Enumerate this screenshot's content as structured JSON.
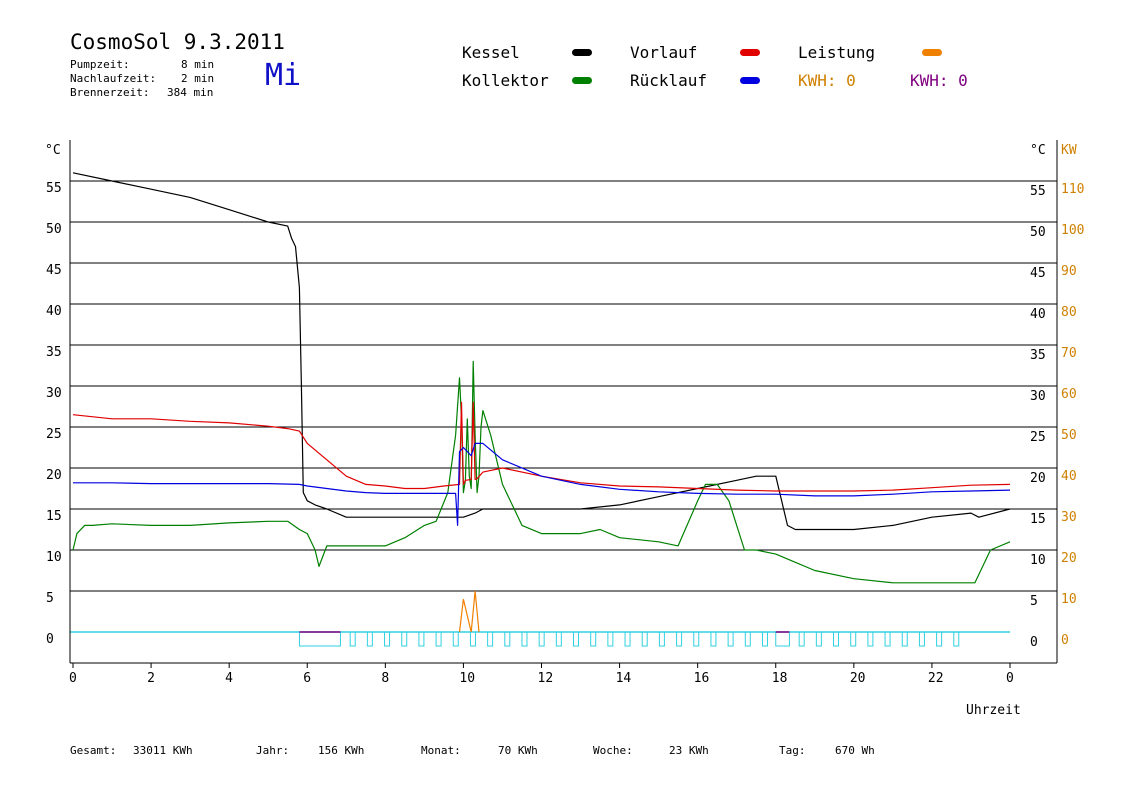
{
  "header": {
    "title": "CosmoSol 9.3.2011",
    "day": "Mi",
    "info": [
      {
        "label": "Pumpzeit:",
        "value": "8 min"
      },
      {
        "label": "Nachlaufzeit:",
        "value": "2 min"
      },
      {
        "label": "Brennerzeit:",
        "value": "384 min"
      }
    ]
  },
  "legend": {
    "kessel": {
      "label": "Kessel",
      "color": "#000000"
    },
    "kollektor": {
      "label": "Kollektor",
      "color": "#008000"
    },
    "vorlauf": {
      "label": "Vorlauf",
      "color": "#e00000"
    },
    "ruecklauf": {
      "label": "Rücklauf",
      "color": "#0000e0"
    },
    "leistung": {
      "label": "Leistung",
      "color": "#f08000"
    },
    "kwh_orange": {
      "label": "KWH: 0",
      "color": "#d08000"
    },
    "kwh_purple": {
      "label": "KWH: 0",
      "color": "#800080"
    }
  },
  "footer": [
    {
      "label": "Gesamt:",
      "value": "33011 KWh"
    },
    {
      "label": "Jahr:",
      "value": "156 KWh"
    },
    {
      "label": "Monat:",
      "value": "70 KWh"
    },
    {
      "label": "Woche:",
      "value": "23 KWh"
    },
    {
      "label": "Tag:",
      "value": "670 Wh"
    }
  ],
  "chart_data": {
    "type": "line",
    "xlabel": "Uhrzeit",
    "ylabel_left": "°C",
    "ylabel_right_1": "°C",
    "ylabel_right_2": "KW",
    "xlim": [
      0,
      24
    ],
    "ylim": [
      0,
      57
    ],
    "x_tick_labels": [
      "0",
      "2",
      "4",
      "6",
      "8",
      "10",
      "12",
      "14",
      "16",
      "18",
      "20",
      "22",
      "0"
    ],
    "y_ticks": [
      0,
      5,
      10,
      15,
      20,
      25,
      30,
      35,
      40,
      45,
      50,
      55
    ],
    "y_tick_labels": [
      "0",
      "5",
      "10",
      "15",
      "20",
      "25",
      "30",
      "35",
      "40",
      "45",
      "50",
      "55"
    ],
    "kw_tick_labels": [
      "0",
      "10",
      "20",
      "30",
      "40",
      "50",
      "60",
      "70",
      "80",
      "90",
      "100",
      "110"
    ],
    "grid": true,
    "series": [
      {
        "name": "Kessel",
        "color": "#000000",
        "x": [
          0,
          1,
          2,
          3,
          4,
          5,
          5.5,
          5.6,
          5.7,
          5.8,
          5.85,
          5.9,
          6,
          6.2,
          6.5,
          7,
          8,
          9,
          9.5,
          9.8,
          10,
          10.3,
          10.5,
          11,
          12,
          13,
          14,
          15,
          16,
          17,
          17.5,
          18,
          18.1,
          18.3,
          18.5,
          19,
          20,
          21,
          22,
          23,
          23.2,
          24
        ],
        "y": [
          56,
          55,
          54,
          53,
          51.5,
          50,
          49.5,
          48,
          47,
          42,
          30,
          17,
          16,
          15.5,
          15,
          14,
          14,
          14,
          14,
          14,
          14,
          14.5,
          15,
          15,
          15,
          15,
          15.5,
          16.5,
          17.5,
          18.5,
          19,
          19,
          17,
          13,
          12.5,
          12.5,
          12.5,
          13,
          14,
          14.5,
          14,
          15
        ]
      },
      {
        "name": "Kollektor",
        "color": "#008000",
        "x": [
          0,
          0.1,
          0.3,
          0.5,
          1,
          2,
          3,
          4,
          5,
          5.5,
          5.8,
          6,
          6.2,
          6.3,
          6.5,
          7,
          7.5,
          8,
          8.5,
          9,
          9.3,
          9.6,
          9.8,
          9.9,
          9.95,
          10,
          10.05,
          10.1,
          10.15,
          10.2,
          10.25,
          10.3,
          10.35,
          10.4,
          10.45,
          10.5,
          10.7,
          11,
          11.5,
          12,
          13,
          13.5,
          14,
          15,
          15.5,
          16,
          16.2,
          16.5,
          16.8,
          17,
          17.2,
          17.5,
          18,
          18.5,
          19,
          20,
          21,
          22,
          23,
          23.1,
          23.5,
          24
        ],
        "y": [
          10,
          12,
          13,
          13,
          13.2,
          13,
          13,
          13.3,
          13.5,
          13.5,
          12.5,
          12,
          10,
          8,
          10.5,
          10.5,
          10.5,
          10.5,
          11.5,
          13,
          13.5,
          17,
          24,
          31,
          26,
          17,
          18.5,
          26,
          19,
          17.5,
          33,
          24,
          17,
          19,
          25,
          27,
          24,
          18,
          13,
          12,
          12,
          12.5,
          11.5,
          11,
          10.5,
          16,
          18,
          18,
          16,
          13,
          10,
          10,
          9.5,
          8.5,
          7.5,
          6.5,
          6,
          6,
          6,
          6,
          10,
          11
        ]
      },
      {
        "name": "Vorlauf",
        "color": "#e00000",
        "x": [
          0,
          1,
          2,
          3,
          4,
          5,
          5.5,
          5.8,
          6,
          6.5,
          7,
          7.5,
          8,
          8.5,
          9,
          9.5,
          9.9,
          9.95,
          10,
          10.05,
          10.2,
          10.25,
          10.3,
          10.35,
          10.5,
          11,
          12,
          13,
          14,
          15,
          16,
          17,
          18,
          19,
          20,
          21,
          22,
          23,
          24
        ],
        "y": [
          26.5,
          26,
          26,
          25.7,
          25.5,
          25.1,
          24.8,
          24.5,
          23,
          21,
          19,
          18,
          17.8,
          17.5,
          17.5,
          17.8,
          18,
          28,
          18,
          18.5,
          18.6,
          28,
          18.6,
          18.7,
          19.5,
          20,
          19,
          18.2,
          17.8,
          17.7,
          17.5,
          17.3,
          17.2,
          17.2,
          17.2,
          17.3,
          17.6,
          17.9,
          18
        ]
      },
      {
        "name": "Rücklauf",
        "color": "#0000e0",
        "x": [
          0,
          1,
          2,
          3,
          4,
          5,
          5.8,
          6,
          7,
          7.5,
          8,
          9,
          9.8,
          9.85,
          9.9,
          10,
          10.2,
          10.3,
          10.5,
          11,
          12,
          13,
          14,
          15,
          16,
          17,
          18,
          19,
          20,
          21,
          22,
          23,
          24
        ],
        "y": [
          18.2,
          18.2,
          18.1,
          18.1,
          18.1,
          18.1,
          18,
          17.8,
          17.2,
          17,
          16.9,
          16.9,
          16.9,
          13,
          22,
          22.5,
          21.5,
          23,
          23,
          21,
          19,
          18,
          17.4,
          17.1,
          16.9,
          16.8,
          16.8,
          16.6,
          16.6,
          16.8,
          17.1,
          17.2,
          17.3
        ]
      }
    ],
    "leistung_kw": {
      "x": [
        9.9,
        10,
        10.2,
        10.3,
        10.4
      ],
      "y": [
        0,
        8,
        0,
        10,
        0
      ]
    }
  }
}
